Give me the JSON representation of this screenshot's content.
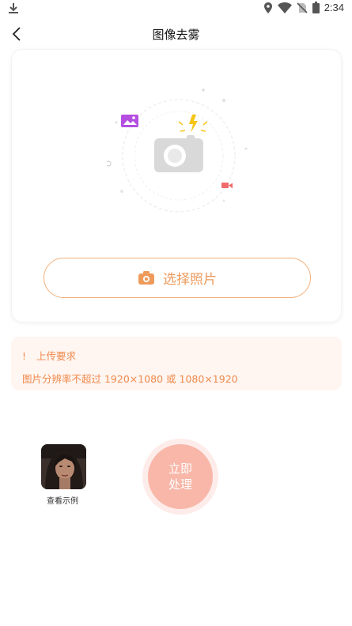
{
  "status_bar": {
    "time": "2:34",
    "icons": [
      "download-icon",
      "location-icon",
      "wifi-icon",
      "no-sim-icon",
      "battery-icon"
    ]
  },
  "nav": {
    "title": "图像去雾",
    "back_icon": "chevron-left-icon"
  },
  "upload": {
    "choose_label": "选择照片",
    "choose_icon": "camera-icon",
    "accent": "#ee9a5b"
  },
  "requirements": {
    "title": "上传要求",
    "text": "图片分辨率不超过 1920×1080 或 1080×1920",
    "color": "#f08a4b"
  },
  "example": {
    "label": "查看示例"
  },
  "process": {
    "line1": "立即",
    "line2": "处理",
    "color": "#f8b7a8"
  }
}
